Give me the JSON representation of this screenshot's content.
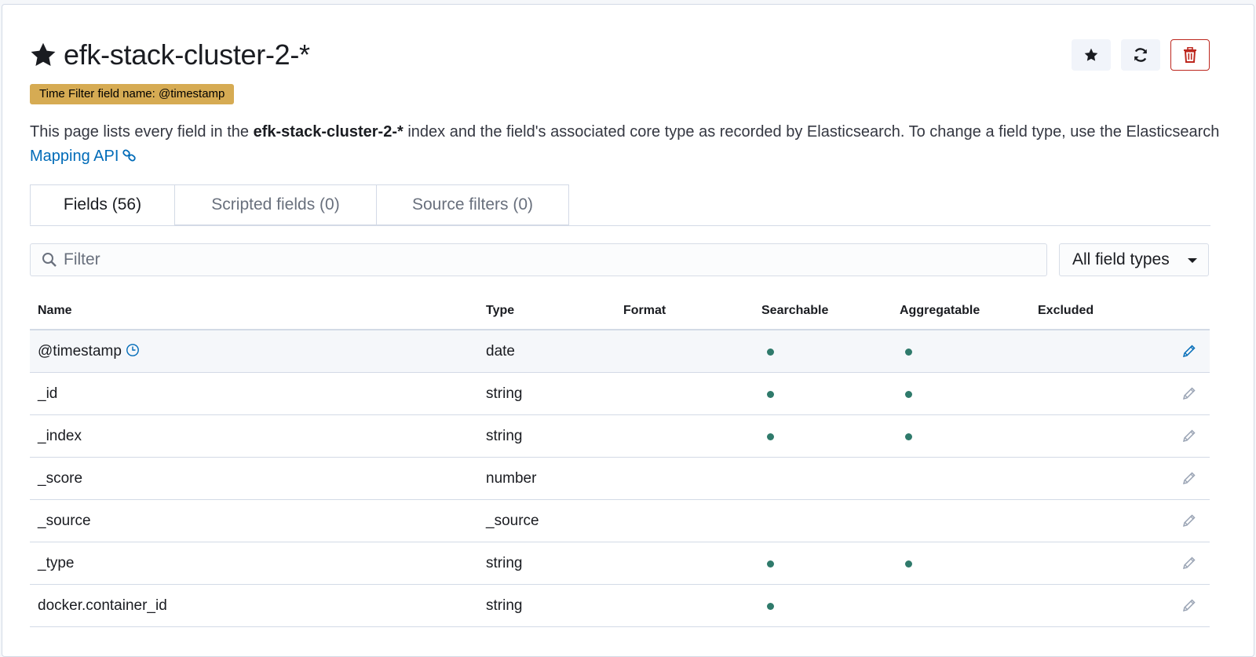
{
  "header": {
    "title": "efk-stack-cluster-2-*",
    "time_filter_badge": "Time Filter field name: @timestamp",
    "description": {
      "before": "This page lists every field in the ",
      "index_name": "efk-stack-cluster-2-*",
      "after": " index and the field's associated core type as recorded by Elasticsearch. To change a field type, use the Elasticsearch ",
      "link": "Mapping API"
    }
  },
  "actions": {
    "favorite_icon": "star-icon",
    "refresh_icon": "refresh-icon",
    "delete_icon": "trash-icon"
  },
  "tabs": [
    {
      "label": "Fields (56)",
      "active": true
    },
    {
      "label": "Scripted fields (0)",
      "active": false
    },
    {
      "label": "Source filters (0)",
      "active": false
    }
  ],
  "filter": {
    "placeholder": "Filter",
    "value": ""
  },
  "type_select": {
    "selected": "All field types"
  },
  "table": {
    "columns": [
      "Name",
      "Type",
      "Format",
      "Searchable",
      "Aggregatable",
      "Excluded"
    ],
    "rows": [
      {
        "name": "@timestamp",
        "type": "date",
        "format": "",
        "searchable": true,
        "aggregatable": true,
        "excluded": false,
        "time_field": true
      },
      {
        "name": "_id",
        "type": "string",
        "format": "",
        "searchable": true,
        "aggregatable": true,
        "excluded": false
      },
      {
        "name": "_index",
        "type": "string",
        "format": "",
        "searchable": true,
        "aggregatable": true,
        "excluded": false
      },
      {
        "name": "_score",
        "type": "number",
        "format": "",
        "searchable": false,
        "aggregatable": false,
        "excluded": false
      },
      {
        "name": "_source",
        "type": "_source",
        "format": "",
        "searchable": false,
        "aggregatable": false,
        "excluded": false
      },
      {
        "name": "_type",
        "type": "string",
        "format": "",
        "searchable": true,
        "aggregatable": true,
        "excluded": false
      },
      {
        "name": "docker.container_id",
        "type": "string",
        "format": "",
        "searchable": true,
        "aggregatable": false,
        "excluded": false
      }
    ]
  },
  "colors": {
    "badge": "#d6ab53",
    "link": "#006bb8",
    "dot": "#2f7a6b",
    "danger": "#bd271e"
  }
}
